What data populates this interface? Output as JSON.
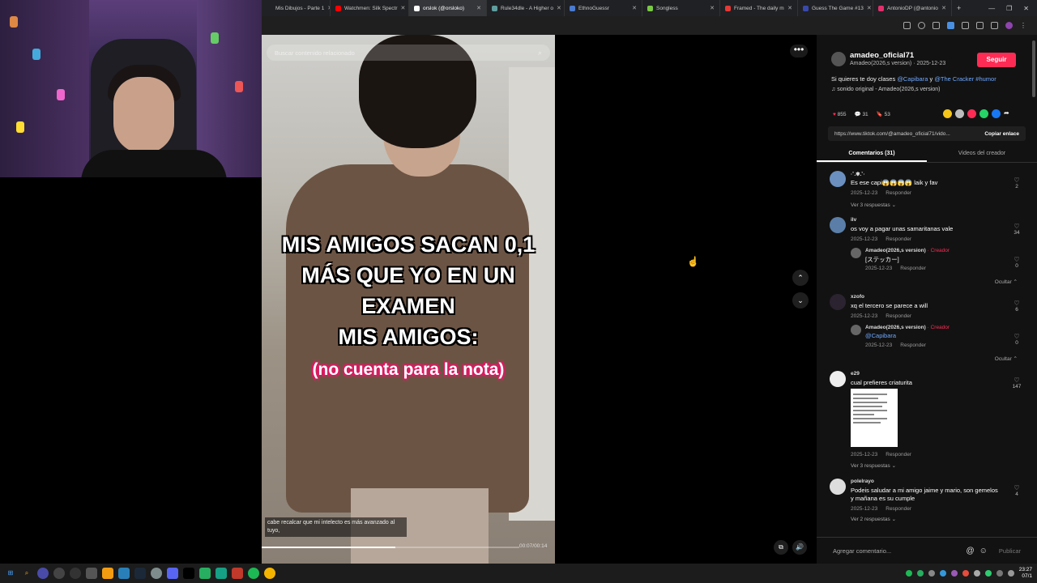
{
  "browser": {
    "tabs": [
      {
        "label": "Mis Dibujos - Parte 1",
        "color": "#888888",
        "active": false
      },
      {
        "label": "Watchmen: Silk Spectr",
        "color": "#ff0000",
        "active": false
      },
      {
        "label": "orslok (@orsloko)",
        "color": "#ffffff",
        "active": true
      },
      {
        "label": "Rule34dle - A Higher o",
        "color": "#5f9ea0",
        "active": false
      },
      {
        "label": "EthnoGuessr",
        "color": "#4a7bd0",
        "active": false
      },
      {
        "label": "Songless",
        "color": "#7ac943",
        "active": false
      },
      {
        "label": "Framed - The daily m",
        "color": "#e53935",
        "active": false
      },
      {
        "label": "Guess The Game #13",
        "color": "#3949ab",
        "active": false
      },
      {
        "label": "AntonioDP (@antonio",
        "color": "#e1306c",
        "active": false
      }
    ],
    "new_tab": "+",
    "window_controls": [
      "—",
      "❐",
      "✕"
    ]
  },
  "video": {
    "search_placeholder": "Buscar contenido relacionado",
    "caption_line1": "MIS AMIGOS SACAN 0,1",
    "caption_line2": "MÁS QUE YO EN UN",
    "caption_line3": "EXAMEN",
    "caption_line4": "MIS AMIGOS:",
    "caption_pink": "(no cuenta para la nota)",
    "subtitle": "cabe recalcar que mi intelecto es más avanzado al tuyo,",
    "time": "00:07/00:14",
    "progress": 0.52,
    "more_icon": "•••",
    "up_icon": "⌃",
    "down_icon": "⌄",
    "pip_icon": "⧉",
    "volume_icon": "🔊"
  },
  "post": {
    "username": "amadeo_oficial71",
    "display": "Amadeo(2026,s version) · 2025-12-23",
    "follow_label": "Seguir",
    "desc_prefix": "Si quieres te doy clases",
    "mention1": "@Capibara",
    "desc_mid": "y",
    "mention2": "@The Cracker",
    "hashtag": "#humor",
    "music": "♫ sonido original - Amadeo(2026,s version)",
    "likes": "855",
    "comments_count": "31",
    "saves": "53",
    "url": "https://www.tiktok.com/@amadeo_oficial71/vido...",
    "copy_label": "Copiar enlace",
    "share_colors": [
      "#f5c518",
      "#bdbdbd",
      "#fe2c55",
      "#25d366",
      "#1877f2"
    ],
    "tab_comments": "Comentarios (31)",
    "tab_videos": "Videos del creador"
  },
  "comments": [
    {
      "user": "·˚.✾.˚·",
      "text": "Es ese capi😱😱😱😱 laik y fav",
      "date": "2025-12-23",
      "reply": "Responder",
      "likes": "2",
      "more": "Ver 3 respuestas ⌄"
    },
    {
      "user": "ilv",
      "text": "os voy a pagar unas samaritanas vale",
      "date": "2025-12-23",
      "reply": "Responder",
      "likes": "34",
      "sub": {
        "user": "Amadeo(2026,s version)",
        "creator": "· Creador",
        "text": "[ステッカー]",
        "date": "2025-12-23",
        "reply": "Responder",
        "likes": "0"
      },
      "hide": "Ocultar ⌃"
    },
    {
      "user": "xzofo",
      "text": "xq el tercero se parece a will",
      "date": "2025-12-23",
      "reply": "Responder",
      "likes": "6",
      "sub": {
        "user": "Amadeo(2026,s version)",
        "creator": "· Creador",
        "text": "@Capibara",
        "date": "2025-12-23",
        "reply": "Responder",
        "likes": "0"
      },
      "hide": "Ocultar ⌃"
    },
    {
      "user": "e29",
      "text": "cual prefieres criaturita",
      "date": "2025-12-23",
      "reply": "Responder",
      "likes": "147",
      "more": "Ver 3 respuestas ⌄"
    },
    {
      "user": "polelrayo",
      "text": "Podeis saludar a mi amigo jaime y mario, son gemelos y mañana es su cumple",
      "date": "2025-12-23",
      "reply": "Responder",
      "likes": "4",
      "more": "Ver 2 respuestas ⌄"
    }
  ],
  "add_comment": {
    "placeholder": "Agregar comentario...",
    "publish": "Publicar"
  },
  "taskbar": {
    "time": "23:27",
    "date": "07/1"
  }
}
